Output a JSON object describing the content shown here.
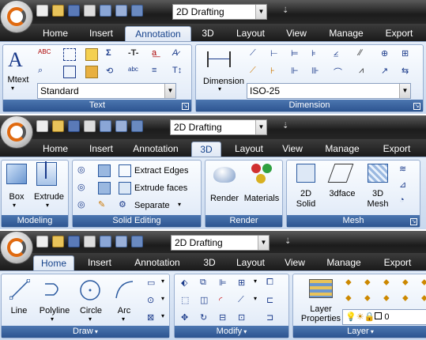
{
  "workspace": "2D Drafting",
  "strip1": {
    "tabs": [
      "Home",
      "Insert",
      "Annotation",
      "3D",
      "Layout",
      "View",
      "Manage",
      "Export"
    ],
    "active_tab": "Annotation",
    "text_panel": {
      "mtext_label": "Mtext",
      "style_value": "Standard",
      "title": "Text"
    },
    "dimension_panel": {
      "dimension_label": "Dimension",
      "style_value": "ISO-25",
      "title": "Dimension"
    }
  },
  "strip2": {
    "tabs": [
      "Home",
      "Insert",
      "Annotation",
      "3D",
      "Layout",
      "View",
      "Manage",
      "Export"
    ],
    "active_tab": "3D",
    "modeling": {
      "box_label": "Box",
      "extrude_label": "Extrude",
      "title": "Modeling"
    },
    "solid_editing": {
      "extract_edges": "Extract Edges",
      "extrude_faces": "Extrude faces",
      "separate": "Separate",
      "title": "Solid Editing"
    },
    "render": {
      "render_label": "Render",
      "materials_label": "Materials",
      "title": "Render"
    },
    "mesh": {
      "solid_label": "2D\nSolid",
      "solid_l1": "2D",
      "solid_l2": "Solid",
      "threedface": "3dface",
      "mesh_l1": "3D",
      "mesh_l2": "Mesh",
      "title": "Mesh"
    }
  },
  "strip3": {
    "tabs": [
      "Home",
      "Insert",
      "Annotation",
      "3D",
      "Layout",
      "View",
      "Manage",
      "Export"
    ],
    "active_tab": "Home",
    "draw": {
      "line": "Line",
      "polyline": "Polyline",
      "circle": "Circle",
      "arc": "Arc",
      "title": "Draw"
    },
    "modify": {
      "title": "Modify"
    },
    "layer": {
      "props_l1": "Layer",
      "props_l2": "Properties",
      "layer_value": "0",
      "title": "Layer"
    }
  },
  "colors": {
    "panel_label": "#2c5490",
    "accent": "#e06a10",
    "text": "#15428b"
  }
}
